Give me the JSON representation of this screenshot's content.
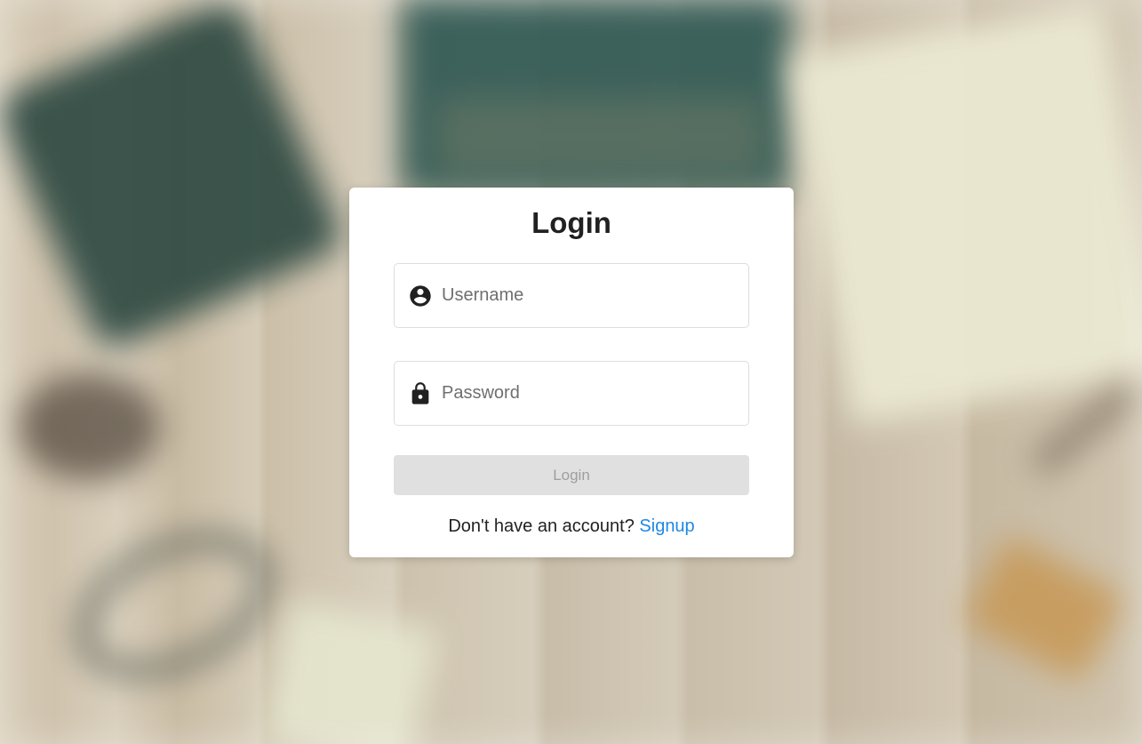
{
  "form": {
    "title": "Login",
    "username": {
      "placeholder": "Username",
      "value": ""
    },
    "password": {
      "placeholder": "Password",
      "value": ""
    },
    "submit_label": "Login",
    "signup_prompt": "Don't have an account?",
    "signup_link": "Signup"
  },
  "icons": {
    "username": "account-circle-icon",
    "password": "lock-icon"
  },
  "colors": {
    "link": "#1e88e5",
    "button_disabled_bg": "#e0e0e0",
    "button_disabled_text": "#9e9e9e",
    "card_bg": "#ffffff"
  }
}
